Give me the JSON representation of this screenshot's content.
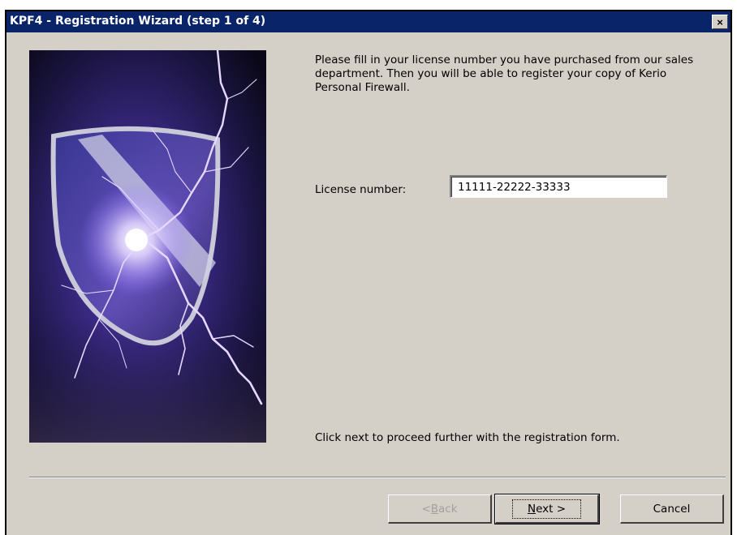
{
  "window": {
    "title": "KPF4 - Registration Wizard (step 1 of 4)",
    "close_glyph": "×"
  },
  "banner": {
    "description_icon": "shield-lightning-image"
  },
  "content": {
    "intro": "Please fill in your license number you have purchased from our sales department. Then you will be able to register your copy of Kerio Personal Firewall.",
    "license_label": "License number:",
    "license_value": "11111-22222-33333",
    "footer": "Click next to proceed further with the registration form."
  },
  "buttons": {
    "back": {
      "prefix": "< ",
      "accel": "B",
      "rest": "ack",
      "enabled": false
    },
    "next": {
      "accel": "N",
      "rest": "ext >"
    },
    "cancel": "Cancel"
  },
  "colors": {
    "titlebar": "#0a246a",
    "dialog_bg": "#d4d0c8",
    "banner_bg": "#12102a"
  }
}
